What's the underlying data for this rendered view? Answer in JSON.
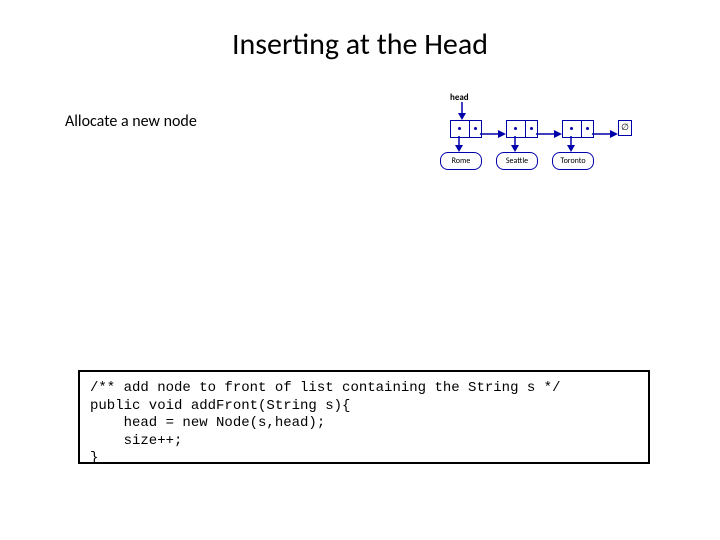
{
  "title": "Inserting at the Head",
  "caption": "Allocate a new node",
  "diagram": {
    "head_label": "head",
    "airports": [
      "Rome",
      "Seattle",
      "Toronto"
    ],
    "null_symbol": "∅"
  },
  "code": {
    "line1": "/** add node to front of list containing the String s */",
    "line2": "public void addFront(String s){",
    "line3": "    head = new Node(s,head);",
    "line4": "    size++;",
    "line5": "}"
  }
}
